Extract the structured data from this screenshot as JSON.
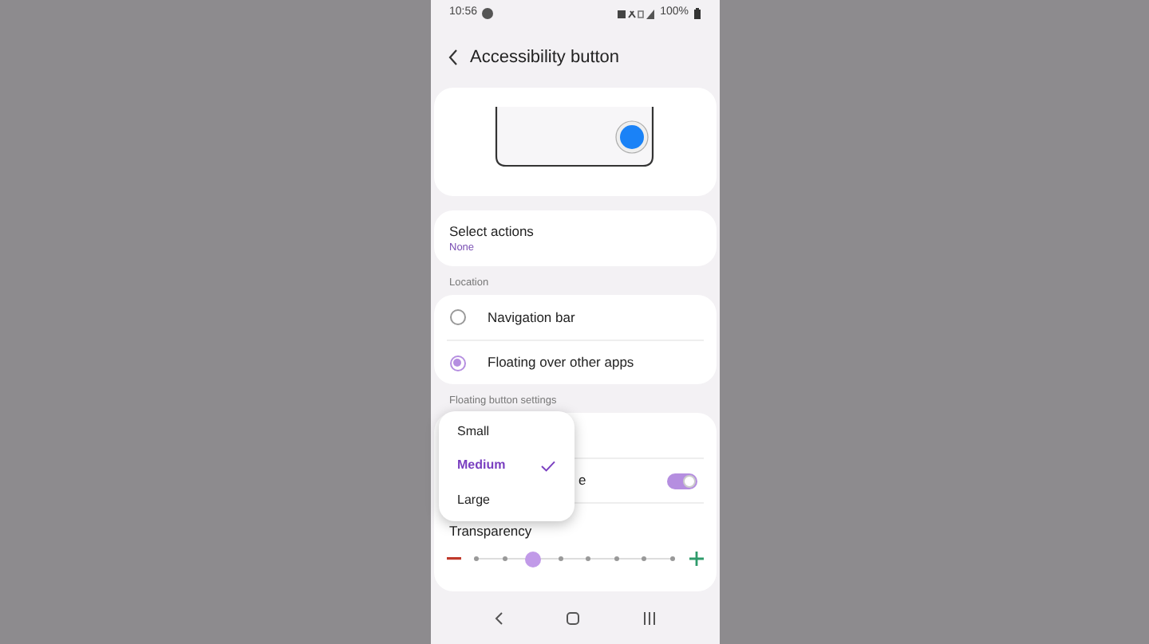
{
  "status_bar": {
    "time": "10:56",
    "battery": "100%"
  },
  "header": {
    "title": "Accessibility button"
  },
  "select_actions": {
    "label": "Select actions",
    "value": "None"
  },
  "location": {
    "heading": "Location",
    "options": [
      {
        "label": "Navigation bar",
        "selected": false
      },
      {
        "label": "Floating over other apps",
        "selected": true
      }
    ]
  },
  "floating_settings": {
    "heading": "Floating button settings",
    "toggle_row": {
      "label": "e",
      "on": true
    },
    "transparency": {
      "label": "Transparency",
      "level": 0.286
    }
  },
  "size_menu": {
    "items": [
      {
        "label": "Small",
        "selected": false
      },
      {
        "label": "Medium",
        "selected": true
      },
      {
        "label": "Large",
        "selected": false
      }
    ]
  }
}
